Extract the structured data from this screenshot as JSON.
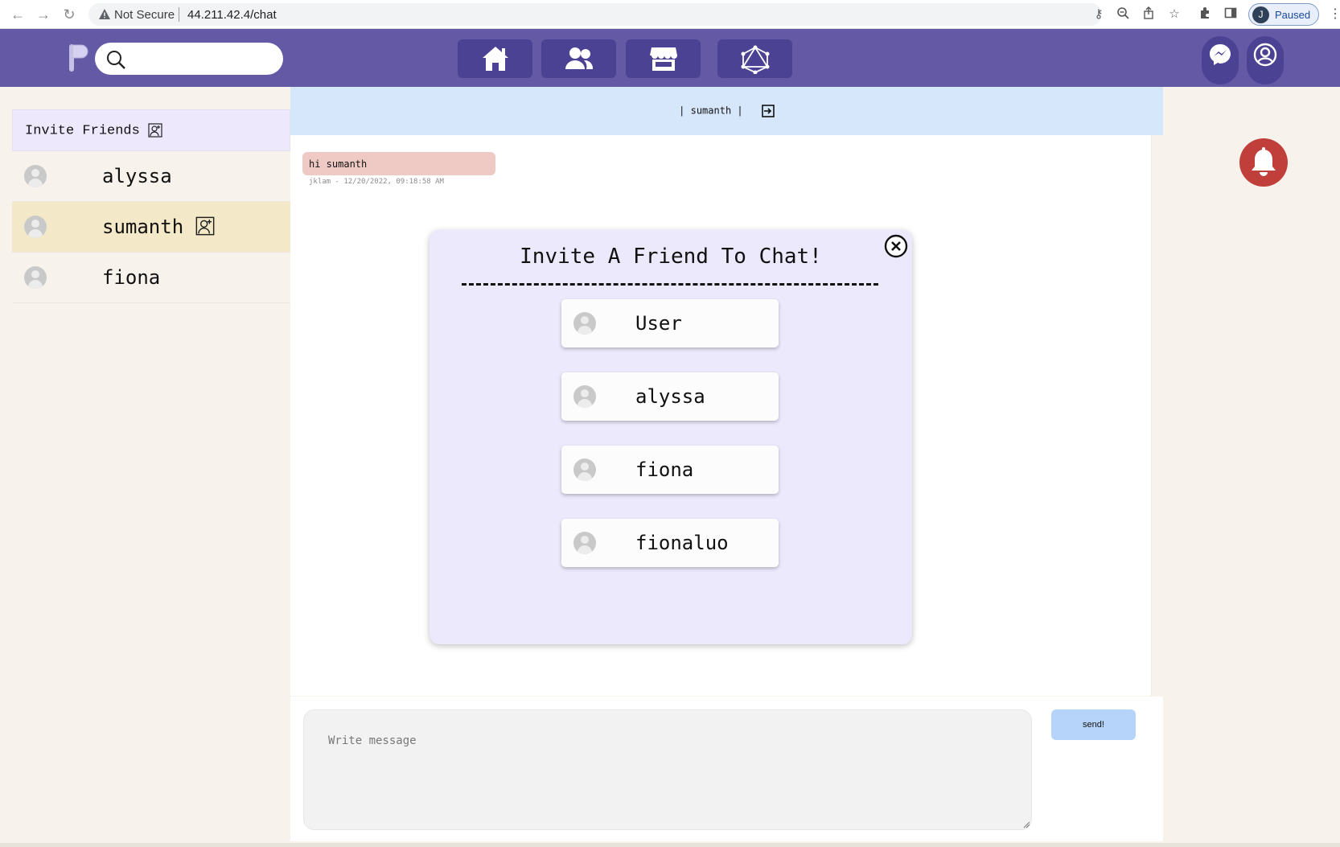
{
  "browser": {
    "security_label": "Not Secure",
    "url": "44.211.42.4/chat",
    "profile_initial": "J",
    "profile_status": "Paused"
  },
  "header": {
    "search_placeholder": "",
    "nav_tabs": [
      "home-icon",
      "friends-icon",
      "marketplace-icon",
      "network-icon"
    ],
    "right_icons": [
      "messenger-icon",
      "account-icon"
    ],
    "accent_color": "#6459a4",
    "tab_color": "#4c4294"
  },
  "sidebar": {
    "invite_label": "Invite Friends",
    "friends": [
      {
        "name": "alyssa",
        "active": false
      },
      {
        "name": "sumanth",
        "active": true
      },
      {
        "name": "fiona",
        "active": false
      }
    ]
  },
  "chat": {
    "header_text": "| sumanth |",
    "messages": [
      {
        "text": "hi sumanth",
        "meta": "jklam - 12/20/2022, 09:18:58 AM"
      }
    ]
  },
  "modal": {
    "title": "Invite A Friend To Chat!",
    "candidates": [
      "User",
      "alyssa",
      "fiona",
      "fionaluo"
    ]
  },
  "composer": {
    "placeholder": "Write message",
    "send_label": "send!"
  },
  "colors": {
    "notification": "#c13f3a",
    "message_bubble": "#efcac4",
    "chat_header": "#d6e6fb",
    "modal_bg": "#ece9fc",
    "active_friend": "#f3e8c7"
  }
}
